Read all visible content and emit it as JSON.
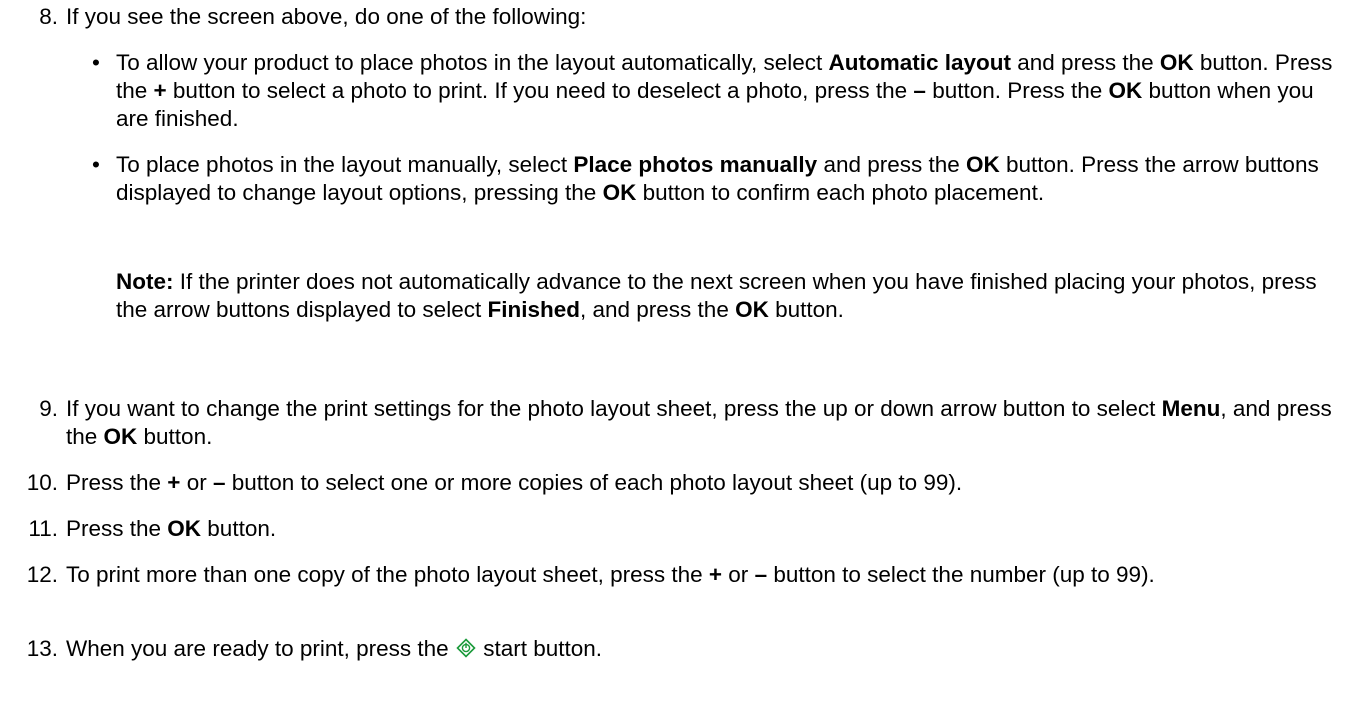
{
  "steps": [
    {
      "num": "8.",
      "parts": [
        "If you see the screen above, do one of the following:"
      ]
    },
    {
      "num": "9.",
      "parts": [
        "If you want to change the print settings for the photo layout sheet, press the up or down arrow button to select ",
        "Menu",
        ", and press the ",
        "OK",
        " button."
      ]
    },
    {
      "num": "10.",
      "parts": [
        "Press the ",
        "+",
        " or ",
        "–",
        " button to select one or more copies of each photo layout sheet (up to 99)."
      ]
    },
    {
      "num": "11.",
      "parts": [
        "Press the ",
        "OK",
        " button."
      ]
    },
    {
      "num": "12.",
      "parts": [
        "To print more than one copy of the photo layout sheet, press the ",
        "+",
        " or ",
        "–",
        " button to select the number (up to 99)."
      ]
    },
    {
      "num": "13.",
      "parts": [
        "When you are ready to print, press the ",
        " start button."
      ]
    }
  ],
  "bullets": [
    {
      "dot": "•",
      "parts": [
        "To allow your product to place photos in the layout automatically, select ",
        "Automatic layout",
        " and press the ",
        "OK",
        " button. Press the ",
        "+",
        " button to select a photo to print. If you need to deselect a photo, press the ",
        "–",
        " button. Press the ",
        "OK",
        " button when you are finished."
      ]
    },
    {
      "dot": "•",
      "parts": [
        "To place photos in the layout manually, select ",
        "Place photos manually",
        " and press the ",
        "OK",
        " button. Press the arrow buttons displayed to change layout options, pressing the ",
        "OK",
        " button to confirm each photo placement."
      ]
    }
  ],
  "note": {
    "parts": [
      "Note:",
      " If the printer does not automatically advance to the next screen when you have finished placing your photos, press the arrow buttons displayed to select ",
      "Finished",
      ", and press the ",
      "OK",
      " button."
    ]
  },
  "icons": {
    "start_icon": "start-diamond-icon",
    "start_color": "#1a9a3a"
  }
}
